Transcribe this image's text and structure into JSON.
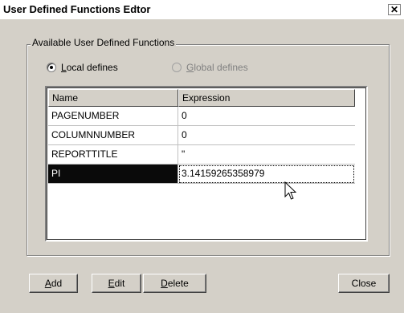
{
  "window": {
    "title": "User Defined Functions Edtor",
    "close_glyph": "✕"
  },
  "group": {
    "label": "Available User Defined Functions",
    "radio_local_label": "Local defines",
    "radio_local_accel": "L",
    "radio_local_rest": "ocal defines",
    "radio_local_selected": true,
    "radio_global_label": "Global defines",
    "radio_global_accel": "G",
    "radio_global_rest": "lobal defines",
    "radio_global_enabled": false
  },
  "table": {
    "columns": [
      "Name",
      "Expression"
    ],
    "rows": [
      {
        "name": "PAGENUMBER",
        "expression": "0"
      },
      {
        "name": "COLUMNNUMBER",
        "expression": "0"
      },
      {
        "name": "REPORTTITLE",
        "expression": "\""
      },
      {
        "name": "PI",
        "expression": "3.14159265358979"
      }
    ],
    "selected_row": 3
  },
  "buttons": {
    "add": {
      "accel": "A",
      "rest": "dd"
    },
    "edit": {
      "accel": "E",
      "rest": "dit"
    },
    "delete": {
      "accel": "D",
      "rest": "elete"
    },
    "close": "Close"
  },
  "icons": {
    "close": "close-icon",
    "cursor": "mouse-pointer-icon",
    "radio": "radio-button-icon"
  },
  "colors": {
    "face": "#d4d0c8",
    "selection": "#0a0a0a"
  }
}
